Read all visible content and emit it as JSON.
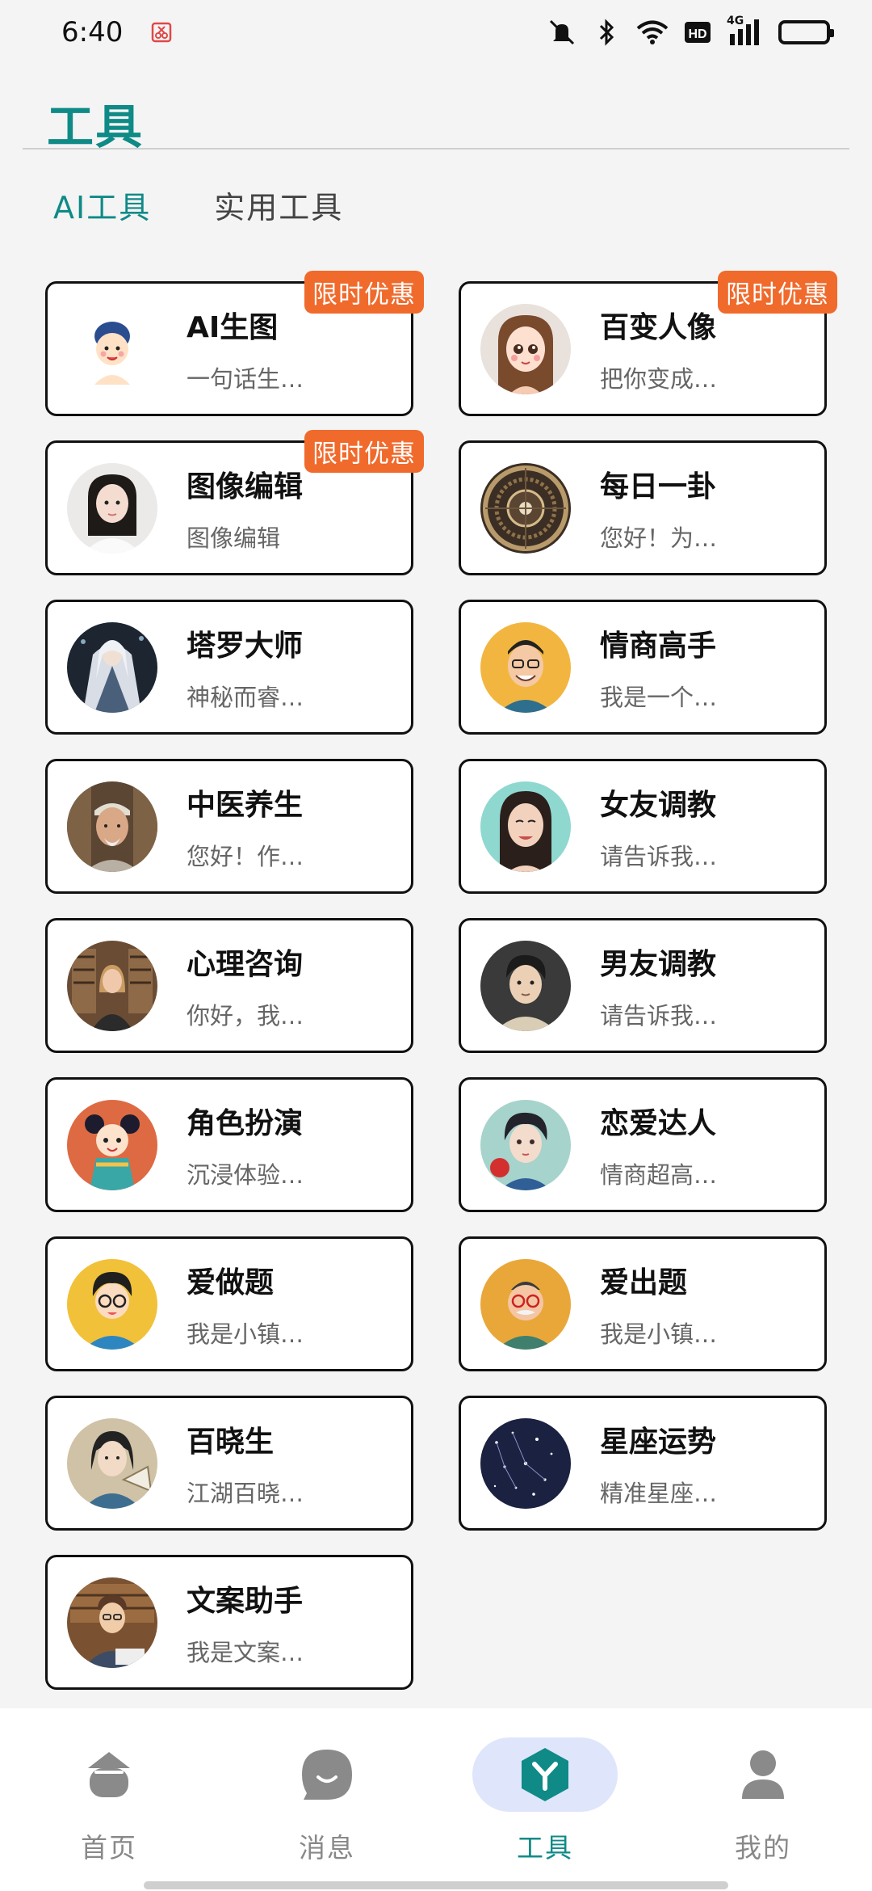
{
  "status_bar": {
    "time": "6:40",
    "network": "4G",
    "hd": "HD",
    "icons": [
      "screenshot-icon",
      "mute-icon",
      "bluetooth-icon",
      "wifi-icon",
      "hd-icon",
      "signal-icon",
      "battery-icon"
    ]
  },
  "header": {
    "title": "工具"
  },
  "tabs": [
    {
      "label": "AI工具",
      "active": true
    },
    {
      "label": "实用工具",
      "active": false
    }
  ],
  "cards": [
    {
      "title": "AI生图",
      "desc": "一句话生…",
      "badge": "限时优惠",
      "avatar": "cartoon-person"
    },
    {
      "title": "百变人像",
      "desc": "把你变成…",
      "badge": "限时优惠",
      "avatar": "cartoon-girl"
    },
    {
      "title": "图像编辑",
      "desc": "图像编辑",
      "badge": "限时优惠",
      "avatar": "woman-portrait"
    },
    {
      "title": "每日一卦",
      "desc": "您好！为…",
      "badge": "",
      "avatar": "bagua-compass"
    },
    {
      "title": "塔罗大师",
      "desc": "神秘而睿…",
      "badge": "",
      "avatar": "tarot-master"
    },
    {
      "title": "情商高手",
      "desc": "我是一个…",
      "badge": "",
      "avatar": "smiling-man"
    },
    {
      "title": "中医养生",
      "desc": "您好！作…",
      "badge": "",
      "avatar": "old-doctor"
    },
    {
      "title": "女友调教",
      "desc": "请告诉我…",
      "badge": "",
      "avatar": "girlfriend"
    },
    {
      "title": "心理咨询",
      "desc": "你好，我…",
      "badge": "",
      "avatar": "counselor"
    },
    {
      "title": "男友调教",
      "desc": "请告诉我…",
      "badge": "",
      "avatar": "boyfriend"
    },
    {
      "title": "角色扮演",
      "desc": "沉浸体验…",
      "badge": "",
      "avatar": "roleplay-character"
    },
    {
      "title": "恋爱达人",
      "desc": "情商超高…",
      "badge": "",
      "avatar": "romance-boy"
    },
    {
      "title": "爱做题",
      "desc": "我是小镇…",
      "badge": "",
      "avatar": "student-boy"
    },
    {
      "title": "爱出题",
      "desc": "我是小镇…",
      "badge": "",
      "avatar": "teacher"
    },
    {
      "title": "百晓生",
      "desc": "江湖百晓…",
      "badge": "",
      "avatar": "scholar"
    },
    {
      "title": "星座运势",
      "desc": "精准星座…",
      "badge": "",
      "avatar": "starry-sky"
    },
    {
      "title": "文案助手",
      "desc": "我是文案…",
      "badge": "",
      "avatar": "writer"
    }
  ],
  "bottom_nav": [
    {
      "label": "首页",
      "icon": "home-icon",
      "active": false
    },
    {
      "label": "消息",
      "icon": "message-icon",
      "active": false
    },
    {
      "label": "工具",
      "icon": "tools-icon",
      "active": true
    },
    {
      "label": "我的",
      "icon": "profile-icon",
      "active": false
    }
  ],
  "colors": {
    "accent": "#0f8a87",
    "badge": "#f06a2c",
    "nav_active_bg": "#dfe6fb",
    "background": "#f4f4f4"
  }
}
